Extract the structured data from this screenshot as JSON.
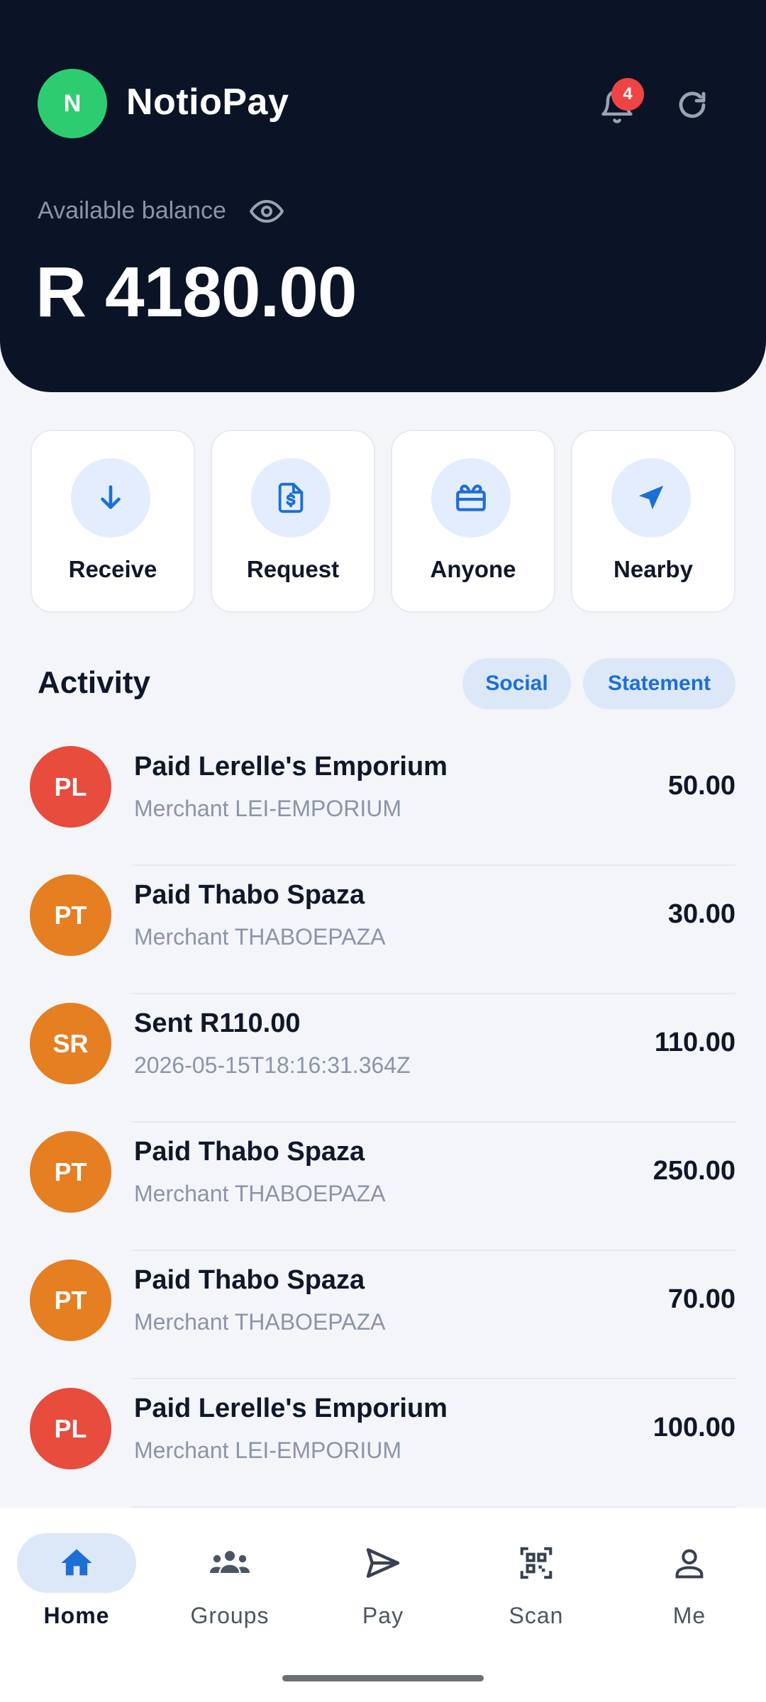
{
  "header": {
    "avatar_initial": "N",
    "app_title": "NotioPay",
    "notification_count": "4",
    "balance_label": "Available balance",
    "balance": "R 4180.00"
  },
  "actions": [
    {
      "label": "Receive",
      "icon": "arrow-down-icon"
    },
    {
      "label": "Request",
      "icon": "invoice-dollar-icon"
    },
    {
      "label": "Anyone",
      "icon": "gift-card-icon"
    },
    {
      "label": "Nearby",
      "icon": "navigation-arrow-icon"
    }
  ],
  "activity": {
    "title": "Activity",
    "tabs": [
      "Social",
      "Statement"
    ],
    "transactions": [
      {
        "initials": "PL",
        "color": "#e74c3c",
        "title": "Paid Lerelle's Emporium",
        "subtitle": "Merchant LEI-EMPORIUM",
        "amount": "50.00"
      },
      {
        "initials": "PT",
        "color": "#e67e22",
        "title": "Paid Thabo Spaza",
        "subtitle": "Merchant THABOEPAZA",
        "amount": "30.00"
      },
      {
        "initials": "SR",
        "color": "#e67e22",
        "title": "Sent R110.00",
        "subtitle": "2026-05-15T18:16:31.364Z",
        "amount": "110.00"
      },
      {
        "initials": "PT",
        "color": "#e67e22",
        "title": "Paid Thabo Spaza",
        "subtitle": "Merchant THABOEPAZA",
        "amount": "250.00"
      },
      {
        "initials": "PT",
        "color": "#e67e22",
        "title": "Paid Thabo Spaza",
        "subtitle": "Merchant THABOEPAZA",
        "amount": "70.00"
      },
      {
        "initials": "PL",
        "color": "#e74c3c",
        "title": "Paid Lerelle's Emporium",
        "subtitle": "Merchant LEI-EMPORIUM",
        "amount": "100.00"
      }
    ]
  },
  "nav": {
    "items": [
      {
        "label": "Home",
        "icon": "home-icon",
        "active": true
      },
      {
        "label": "Groups",
        "icon": "groups-icon",
        "active": false
      },
      {
        "label": "Pay",
        "icon": "send-icon",
        "active": false
      },
      {
        "label": "Scan",
        "icon": "qr-scan-icon",
        "active": false
      },
      {
        "label": "Me",
        "icon": "person-icon",
        "active": false
      }
    ]
  },
  "colors": {
    "header_bg": "#0b1426",
    "accent": "#1d6fd6",
    "avatar_green": "#2ecc71",
    "badge_red": "#ef4444"
  }
}
